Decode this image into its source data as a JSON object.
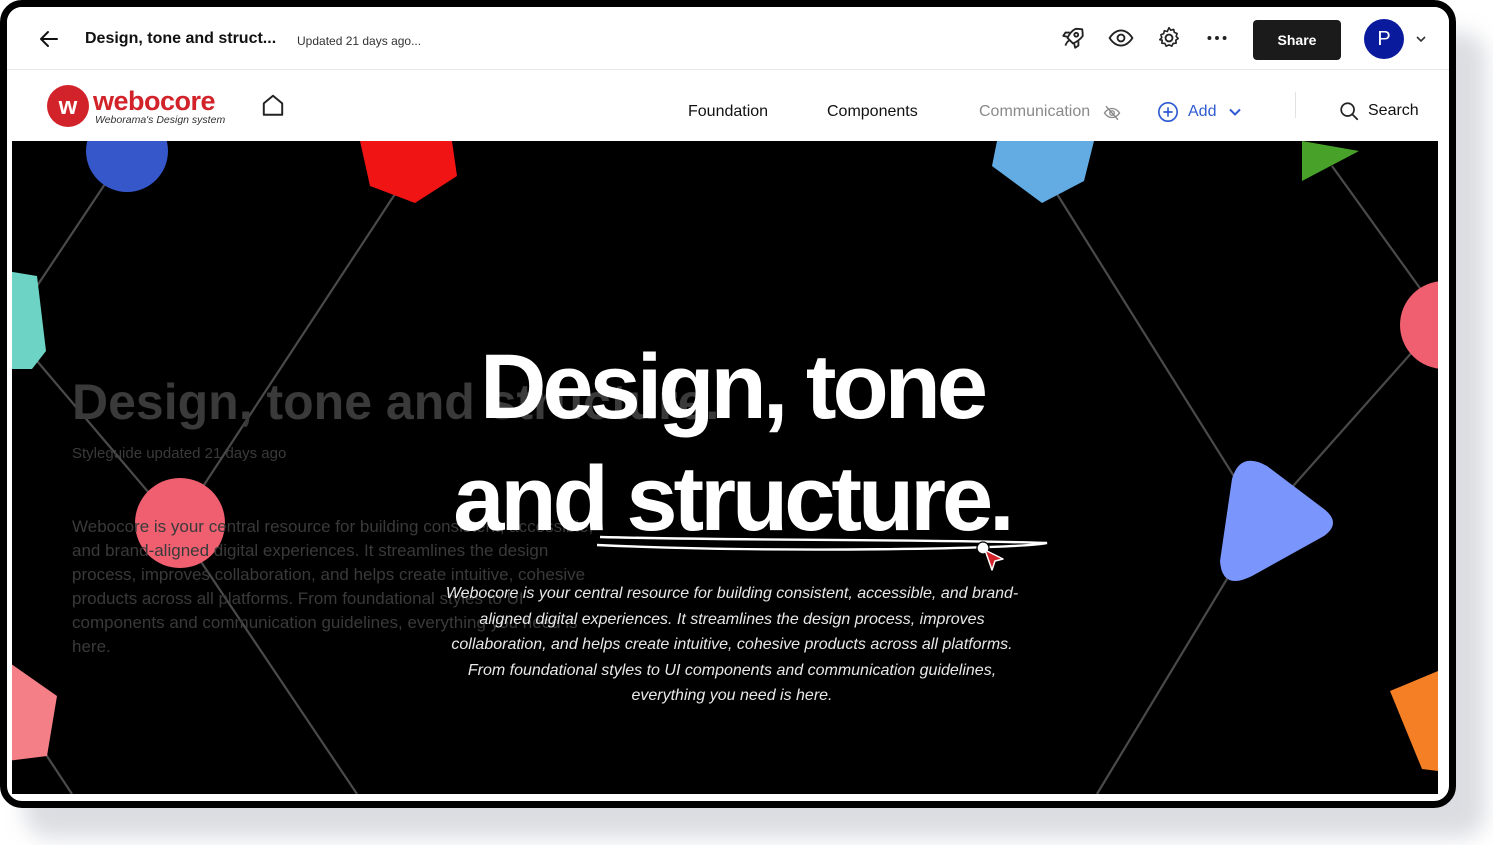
{
  "app": {
    "doc_title": "Design, tone and struct...",
    "updated": "Updated 21 days ago...",
    "share_label": "Share",
    "avatar_initial": "P"
  },
  "site": {
    "logo_name": "webocore",
    "logo_tagline": "Weborama's Design system",
    "nav": {
      "foundation": "Foundation",
      "components": "Components",
      "communication": "Communication",
      "add": "Add",
      "search": "Search"
    }
  },
  "hero": {
    "title_line1": "Design, tone",
    "title_line2": "and structure.",
    "body": "Webocore is your central resource for building consistent, accessible, and brand-aligned digital experiences. It streamlines the design process, improves collaboration, and helps create intuitive, cohesive products across all platforms. From foundational styles to UI components and communication guidelines, everything you need is here.",
    "ghost_title": "Design, tone and structure.",
    "ghost_subtitle": "Styleguide updated 21 days ago",
    "ghost_body": "Webocore is your central resource for building consistent, accessible, and brand-aligned digital experiences. It streamlines the design process, improves collaboration, and helps create intuitive, cohesive products across all platforms. From foundational styles to UI components and communication guidelines, everything you need is here."
  },
  "colors": {
    "brand_red": "#d2232a",
    "accent_blue": "#2e5bd1",
    "share_bg": "#1b1b1b",
    "avatar_bg": "#0a1a9c",
    "hero_bg": "#000000"
  },
  "icons": [
    "back-arrow-icon",
    "rocket-icon",
    "eye-icon",
    "gear-icon",
    "more-icon",
    "chevron-down-icon",
    "home-icon",
    "eye-off-icon",
    "plus-circle-icon",
    "search-icon",
    "cursor-icon"
  ]
}
